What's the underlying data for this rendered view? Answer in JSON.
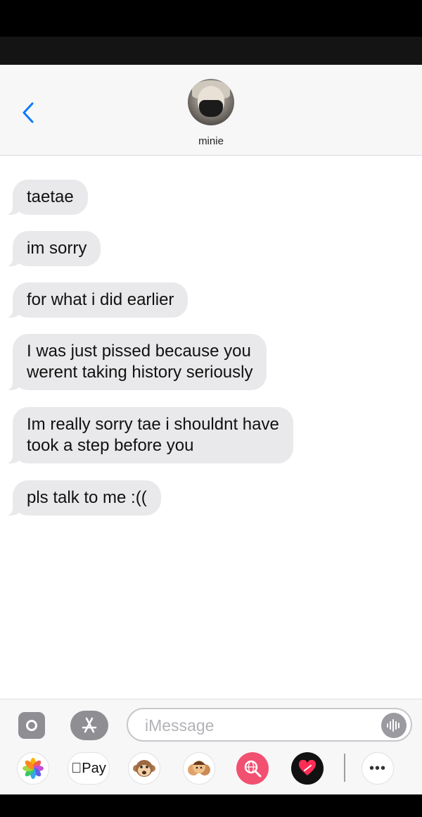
{
  "conversation": {
    "contact_name": "minie"
  },
  "messages": [
    "taetae",
    "im sorry",
    "for what i did earlier",
    "I was just pissed because you\nwerent taking history seriously",
    "Im really sorry tae i shouldnt have\ntook a step before you",
    "pls talk to me :(("
  ],
  "composer": {
    "placeholder": "iMessage",
    "value": ""
  },
  "app_strip": {
    "apple_pay_label": "Pay",
    "more_label": "•••"
  },
  "icons": {
    "back": "chevron-left-icon",
    "camera": "camera-icon",
    "app_store": "app-store-icon",
    "audio": "audio-waveform-icon",
    "photos": "photos-flower-icon",
    "animoji": "monkey-animoji-icon",
    "memoji": "memoji-icon",
    "search": "globe-search-icon",
    "heart": "heart-icon",
    "more": "more-dots-icon"
  },
  "colors": {
    "accent": "#0a7aff",
    "bubble_incoming": "#e9e9eb",
    "search_app": "#f25071"
  }
}
